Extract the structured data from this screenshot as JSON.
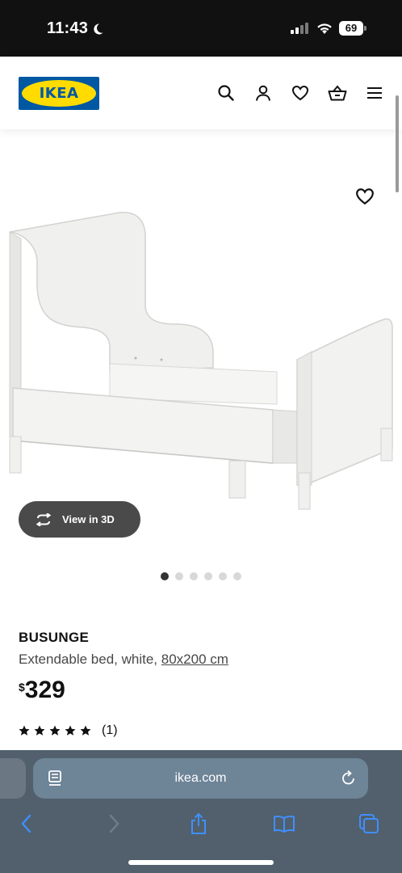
{
  "status_bar": {
    "time": "11:43",
    "battery": "69",
    "icons": [
      "moon-icon",
      "signal-icon",
      "wifi-icon",
      "battery-icon"
    ]
  },
  "header": {
    "logo_text": "IKEA",
    "icons": [
      "search-icon",
      "account-icon",
      "heart-icon",
      "basket-icon",
      "menu-icon"
    ]
  },
  "gallery": {
    "view_3d_label": "View in 3D",
    "image_count": 6,
    "active_index": 0
  },
  "product": {
    "name": "BUSUNGE",
    "description": "Extendable bed, white,",
    "size": "80x200 cm",
    "price_currency": "$",
    "price": "329",
    "rating_stars": 5,
    "review_count": "(1)"
  },
  "browser": {
    "url": "ikea.com",
    "toolbar_icons": [
      "back-icon",
      "forward-icon",
      "share-icon",
      "bookmarks-icon",
      "tabs-icon"
    ]
  },
  "colors": {
    "ikea_blue": "#0058a3",
    "ikea_yellow": "#ffdb00",
    "safari_bar": "#51606c",
    "safari_accent": "#3f8fff"
  }
}
